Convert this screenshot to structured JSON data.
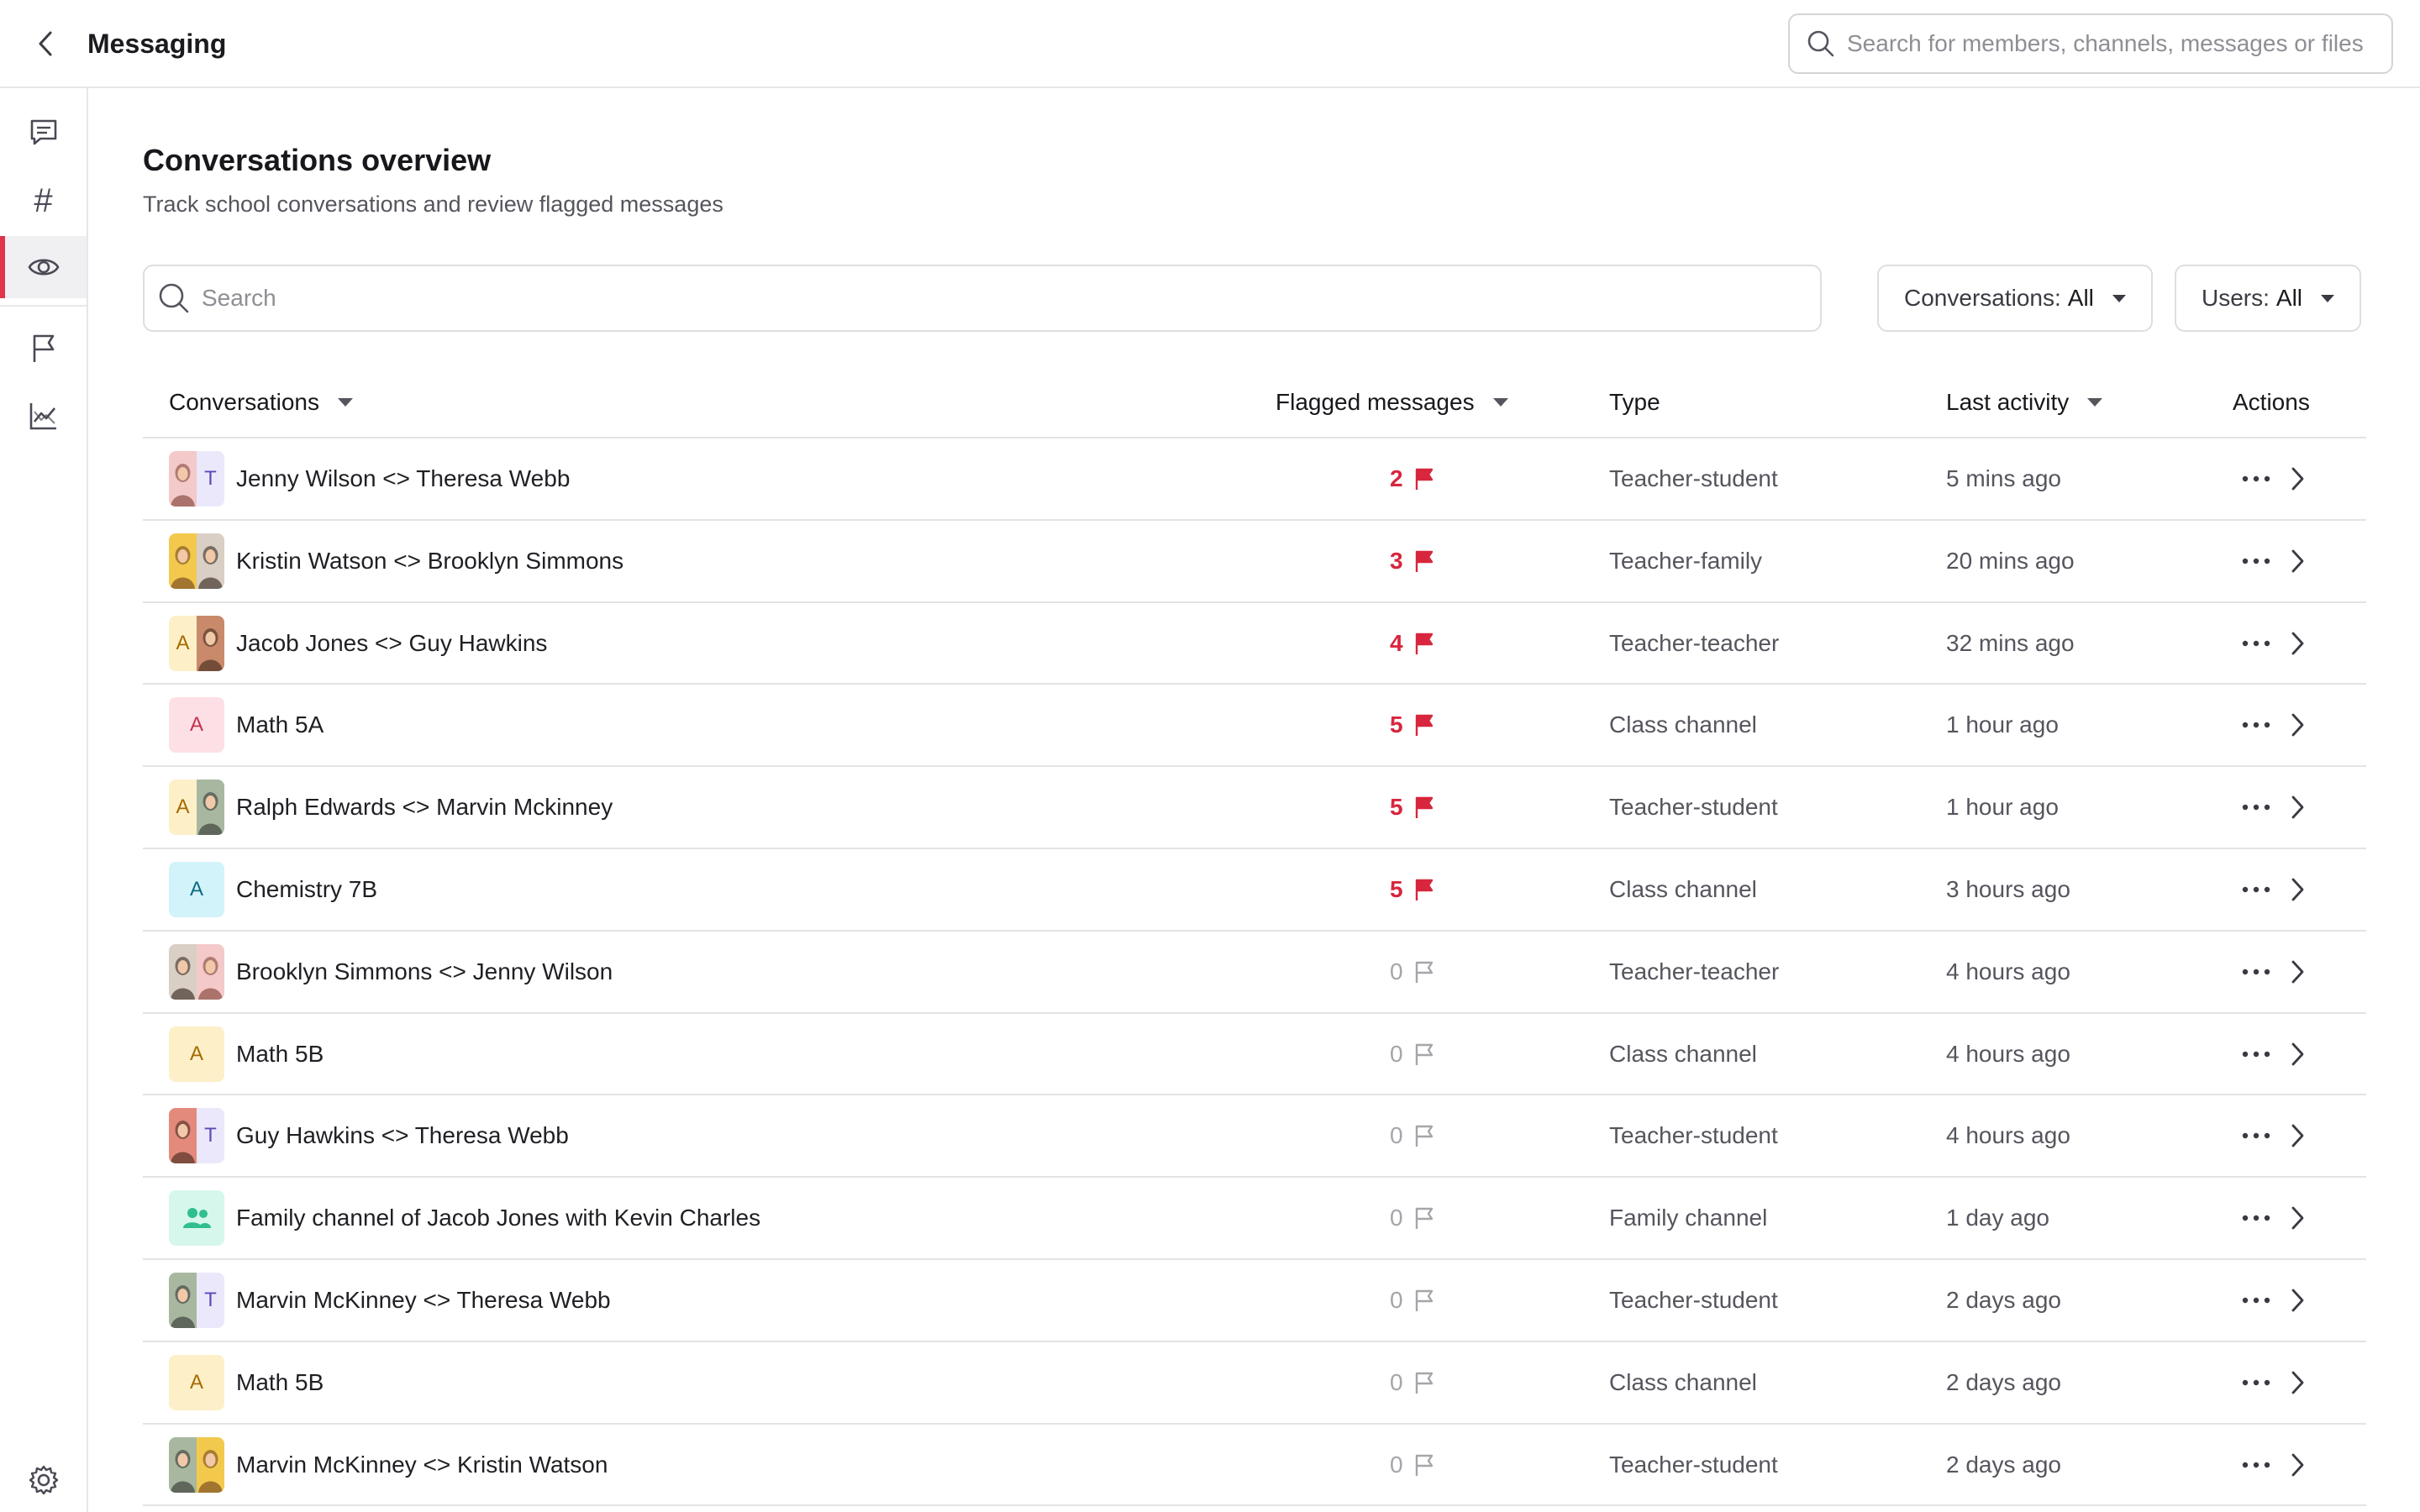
{
  "app": {
    "title": "Messaging"
  },
  "global_search": {
    "placeholder": "Search for members, channels, messages or files"
  },
  "page": {
    "title": "Conversations overview",
    "subtitle": "Track school conversations and review flagged messages"
  },
  "search": {
    "placeholder": "Search"
  },
  "filters": {
    "conversations": {
      "label": "Conversations:",
      "value": "All"
    },
    "users": {
      "label": "Users:",
      "value": "All"
    }
  },
  "columns": {
    "conversations": "Conversations",
    "flagged": "Flagged messages",
    "type": "Type",
    "last_activity": "Last activity",
    "actions": "Actions"
  },
  "colors": {
    "accent": "#e0344a",
    "flag": "#d7263d",
    "muted": "#a5a5ab"
  },
  "rows": [
    {
      "name": "Jenny Wilson <> Theresa Webb",
      "flagged": "2",
      "type": "Teacher-student",
      "last": "5 mins ago",
      "avatar": {
        "kind": "split",
        "left": {
          "photo": true,
          "bg": "#f4c9c9",
          "fg": "#7a3b2e"
        },
        "right": {
          "letter": "T",
          "bg": "#ece8fb",
          "fg": "#5a4ab8"
        }
      }
    },
    {
      "name": "Kristin Watson <> Brooklyn Simmons",
      "flagged": "3",
      "type": "Teacher-family",
      "last": "20 mins ago",
      "avatar": {
        "kind": "split",
        "left": {
          "photo": true,
          "bg": "#f2c94c",
          "fg": "#6b3e1e"
        },
        "right": {
          "photo": true,
          "bg": "#d9cfc4",
          "fg": "#2b1c14"
        }
      }
    },
    {
      "name": "Jacob Jones <> Guy Hawkins",
      "flagged": "4",
      "type": "Teacher-teacher",
      "last": "32 mins ago",
      "avatar": {
        "kind": "split",
        "left": {
          "letter": "A",
          "bg": "#fdf0c8",
          "fg": "#a66a00"
        },
        "right": {
          "photo": true,
          "bg": "#c9896b",
          "fg": "#3b2418"
        }
      }
    },
    {
      "name": "Math 5A",
      "flagged": "5",
      "type": "Class channel",
      "last": "1 hour ago",
      "avatar": {
        "kind": "full",
        "letter": "A",
        "bg": "#fde0e6",
        "fg": "#c2334d"
      }
    },
    {
      "name": "Ralph Edwards <> Marvin Mckinney",
      "flagged": "5",
      "type": "Teacher-student",
      "last": "1 hour ago",
      "avatar": {
        "kind": "split",
        "left": {
          "letter": "A",
          "bg": "#fdf0c8",
          "fg": "#a66a00"
        },
        "right": {
          "photo": true,
          "bg": "#a8b8a0",
          "fg": "#2e2e2e"
        }
      }
    },
    {
      "name": "Chemistry 7B",
      "flagged": "5",
      "type": "Class channel",
      "last": "3 hours ago",
      "avatar": {
        "kind": "full",
        "letter": "A",
        "bg": "#d3f3fb",
        "fg": "#0d6b80"
      }
    },
    {
      "name": "Brooklyn Simmons <> Jenny Wilson",
      "flagged": "0",
      "type": "Teacher-teacher",
      "last": "4 hours ago",
      "avatar": {
        "kind": "split",
        "left": {
          "photo": true,
          "bg": "#d9cfc4",
          "fg": "#2b1c14"
        },
        "right": {
          "photo": true,
          "bg": "#f4c9c9",
          "fg": "#7a3b2e"
        }
      }
    },
    {
      "name": "Math 5B",
      "flagged": "0",
      "type": "Class channel",
      "last": "4 hours ago",
      "avatar": {
        "kind": "full",
        "letter": "A",
        "bg": "#fdf0c8",
        "fg": "#a66a00"
      }
    },
    {
      "name": "Guy Hawkins <> Theresa Webb",
      "flagged": "0",
      "type": "Teacher-student",
      "last": "4 hours ago",
      "avatar": {
        "kind": "split",
        "left": {
          "photo": true,
          "bg": "#e48a7c",
          "fg": "#3b2418"
        },
        "right": {
          "letter": "T",
          "bg": "#ece8fb",
          "fg": "#5a4ab8"
        }
      }
    },
    {
      "name": "Family channel of Jacob Jones with Kevin Charles",
      "flagged": "0",
      "type": "Family channel",
      "last": "1 day ago",
      "avatar": {
        "kind": "family",
        "bg": "#d6f7ec",
        "fg": "#2fbf8f"
      }
    },
    {
      "name": "Marvin McKinney <> Theresa Webb",
      "flagged": "0",
      "type": "Teacher-student",
      "last": "2 days ago",
      "avatar": {
        "kind": "split",
        "left": {
          "photo": true,
          "bg": "#a8b8a0",
          "fg": "#2e2e2e"
        },
        "right": {
          "letter": "T",
          "bg": "#ece8fb",
          "fg": "#5a4ab8"
        }
      }
    },
    {
      "name": "Math 5B",
      "flagged": "0",
      "type": "Class channel",
      "last": "2 days ago",
      "avatar": {
        "kind": "full",
        "letter": "A",
        "bg": "#fdf0c8",
        "fg": "#a66a00"
      }
    },
    {
      "name": "Marvin McKinney <> Kristin Watson",
      "flagged": "0",
      "type": "Teacher-student",
      "last": "2 days ago",
      "avatar": {
        "kind": "split",
        "left": {
          "photo": true,
          "bg": "#a8b8a0",
          "fg": "#2e2e2e"
        },
        "right": {
          "photo": true,
          "bg": "#f2c94c",
          "fg": "#6b3e1e"
        }
      }
    }
  ]
}
